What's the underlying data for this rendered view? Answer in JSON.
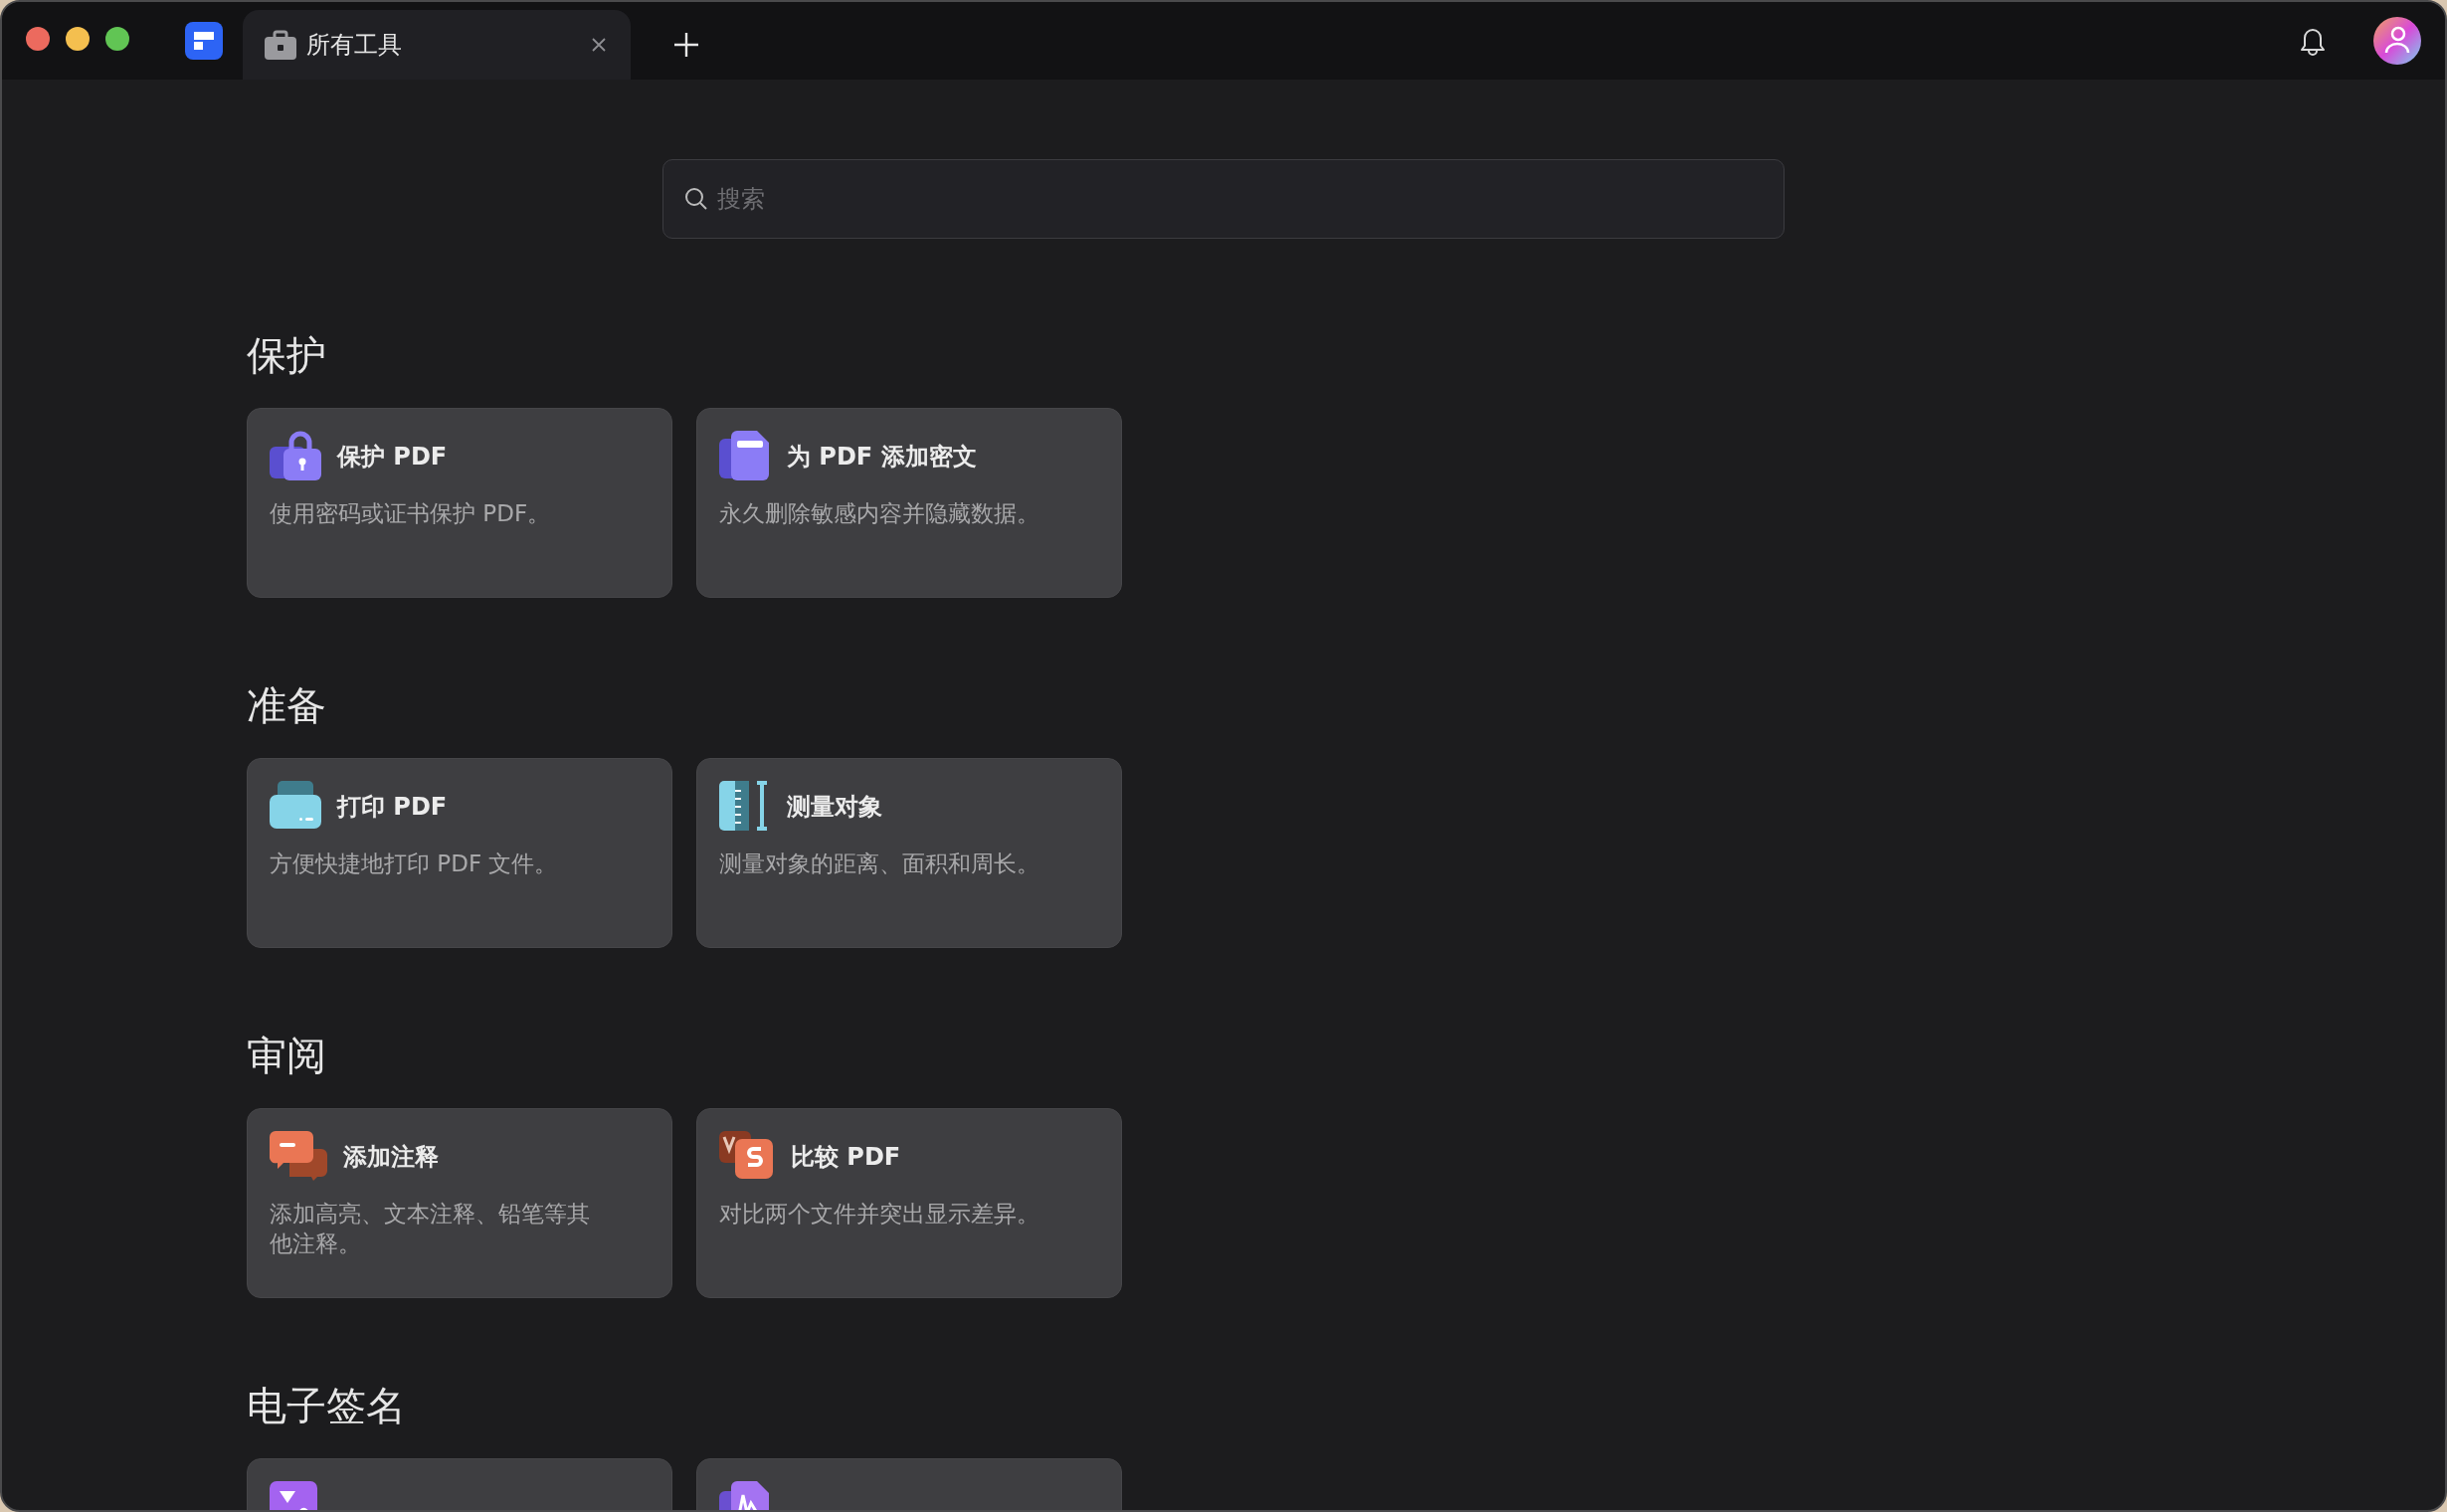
{
  "tabs": [
    {
      "label": "所有工具",
      "selected": true
    }
  ],
  "search": {
    "placeholder": "搜索"
  },
  "sections": [
    {
      "title": "保护",
      "tools": [
        {
          "kind": "lock",
          "title": "保护 PDF",
          "description": "使用密码或证书保护 PDF。"
        },
        {
          "kind": "redact",
          "title": "为 PDF 添加密文",
          "description": "永久删除敏感内容并隐藏数据。"
        }
      ]
    },
    {
      "title": "准备",
      "tools": [
        {
          "kind": "print",
          "title": "打印 PDF",
          "description": "方便快捷地打印 PDF 文件。"
        },
        {
          "kind": "measure",
          "title": "测量对象",
          "description": "测量对象的距离、面积和周长。"
        }
      ]
    },
    {
      "title": "审阅",
      "tools": [
        {
          "kind": "comment",
          "title": "添加注释",
          "description": "添加高亮、文本注释、铅笔等其他注释。"
        },
        {
          "kind": "compare",
          "title": "比较 PDF",
          "description": "对比两个文件并突出显示差异。"
        }
      ]
    },
    {
      "title": "电子签名",
      "tools": [
        {
          "kind": "sign"
        },
        {
          "kind": "fill"
        }
      ]
    }
  ]
}
